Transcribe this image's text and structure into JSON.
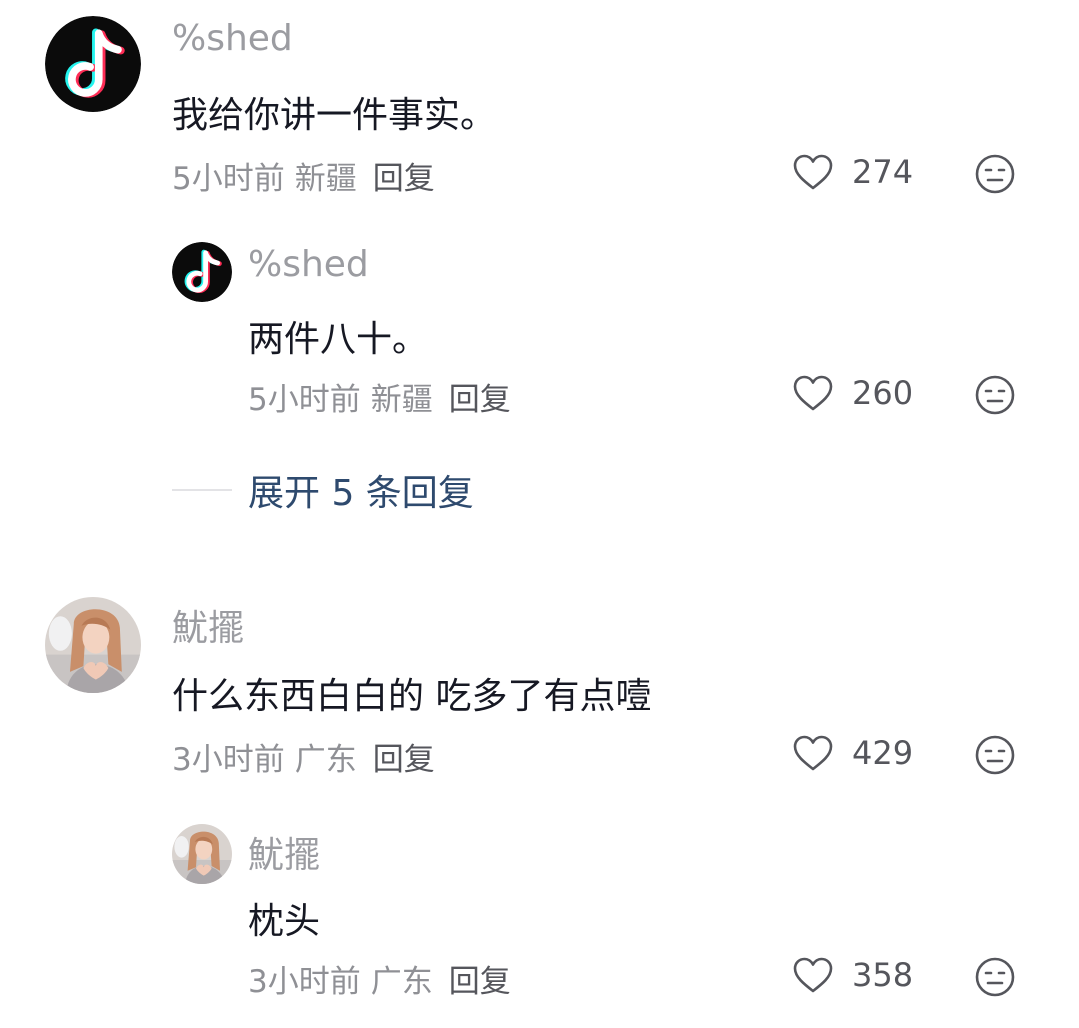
{
  "comments": [
    {
      "username": "%shed",
      "text": "我给你讲一件事实。",
      "time": "5小时前",
      "location": "新疆",
      "reply_label": "回复",
      "likes": "274",
      "avatar_icon": "tiktok-note-icon",
      "replies": [
        {
          "username": "%shed",
          "text": "两件八十。",
          "time": "5小时前",
          "location": "新疆",
          "reply_label": "回复",
          "likes": "260",
          "avatar_icon": "tiktok-note-icon"
        }
      ],
      "expand_label": "展开 5 条回复"
    },
    {
      "username": "魷擺",
      "text": "什么东西白白的 吃多了有点噎",
      "time": "3小时前",
      "location": "广东",
      "reply_label": "回复",
      "likes": "429",
      "avatar_icon": "user-photo-avatar",
      "replies": [
        {
          "username": "魷擺",
          "text": "枕头",
          "time": "3小时前",
          "location": "广东",
          "reply_label": "回复",
          "likes": "358",
          "avatar_icon": "user-photo-avatar"
        }
      ]
    }
  ],
  "colors": {
    "username": "#9b9ca1",
    "text": "#161823",
    "meta": "#8f9095",
    "expand_link": "#2e4a6e",
    "icon_stroke": "#55565c"
  }
}
